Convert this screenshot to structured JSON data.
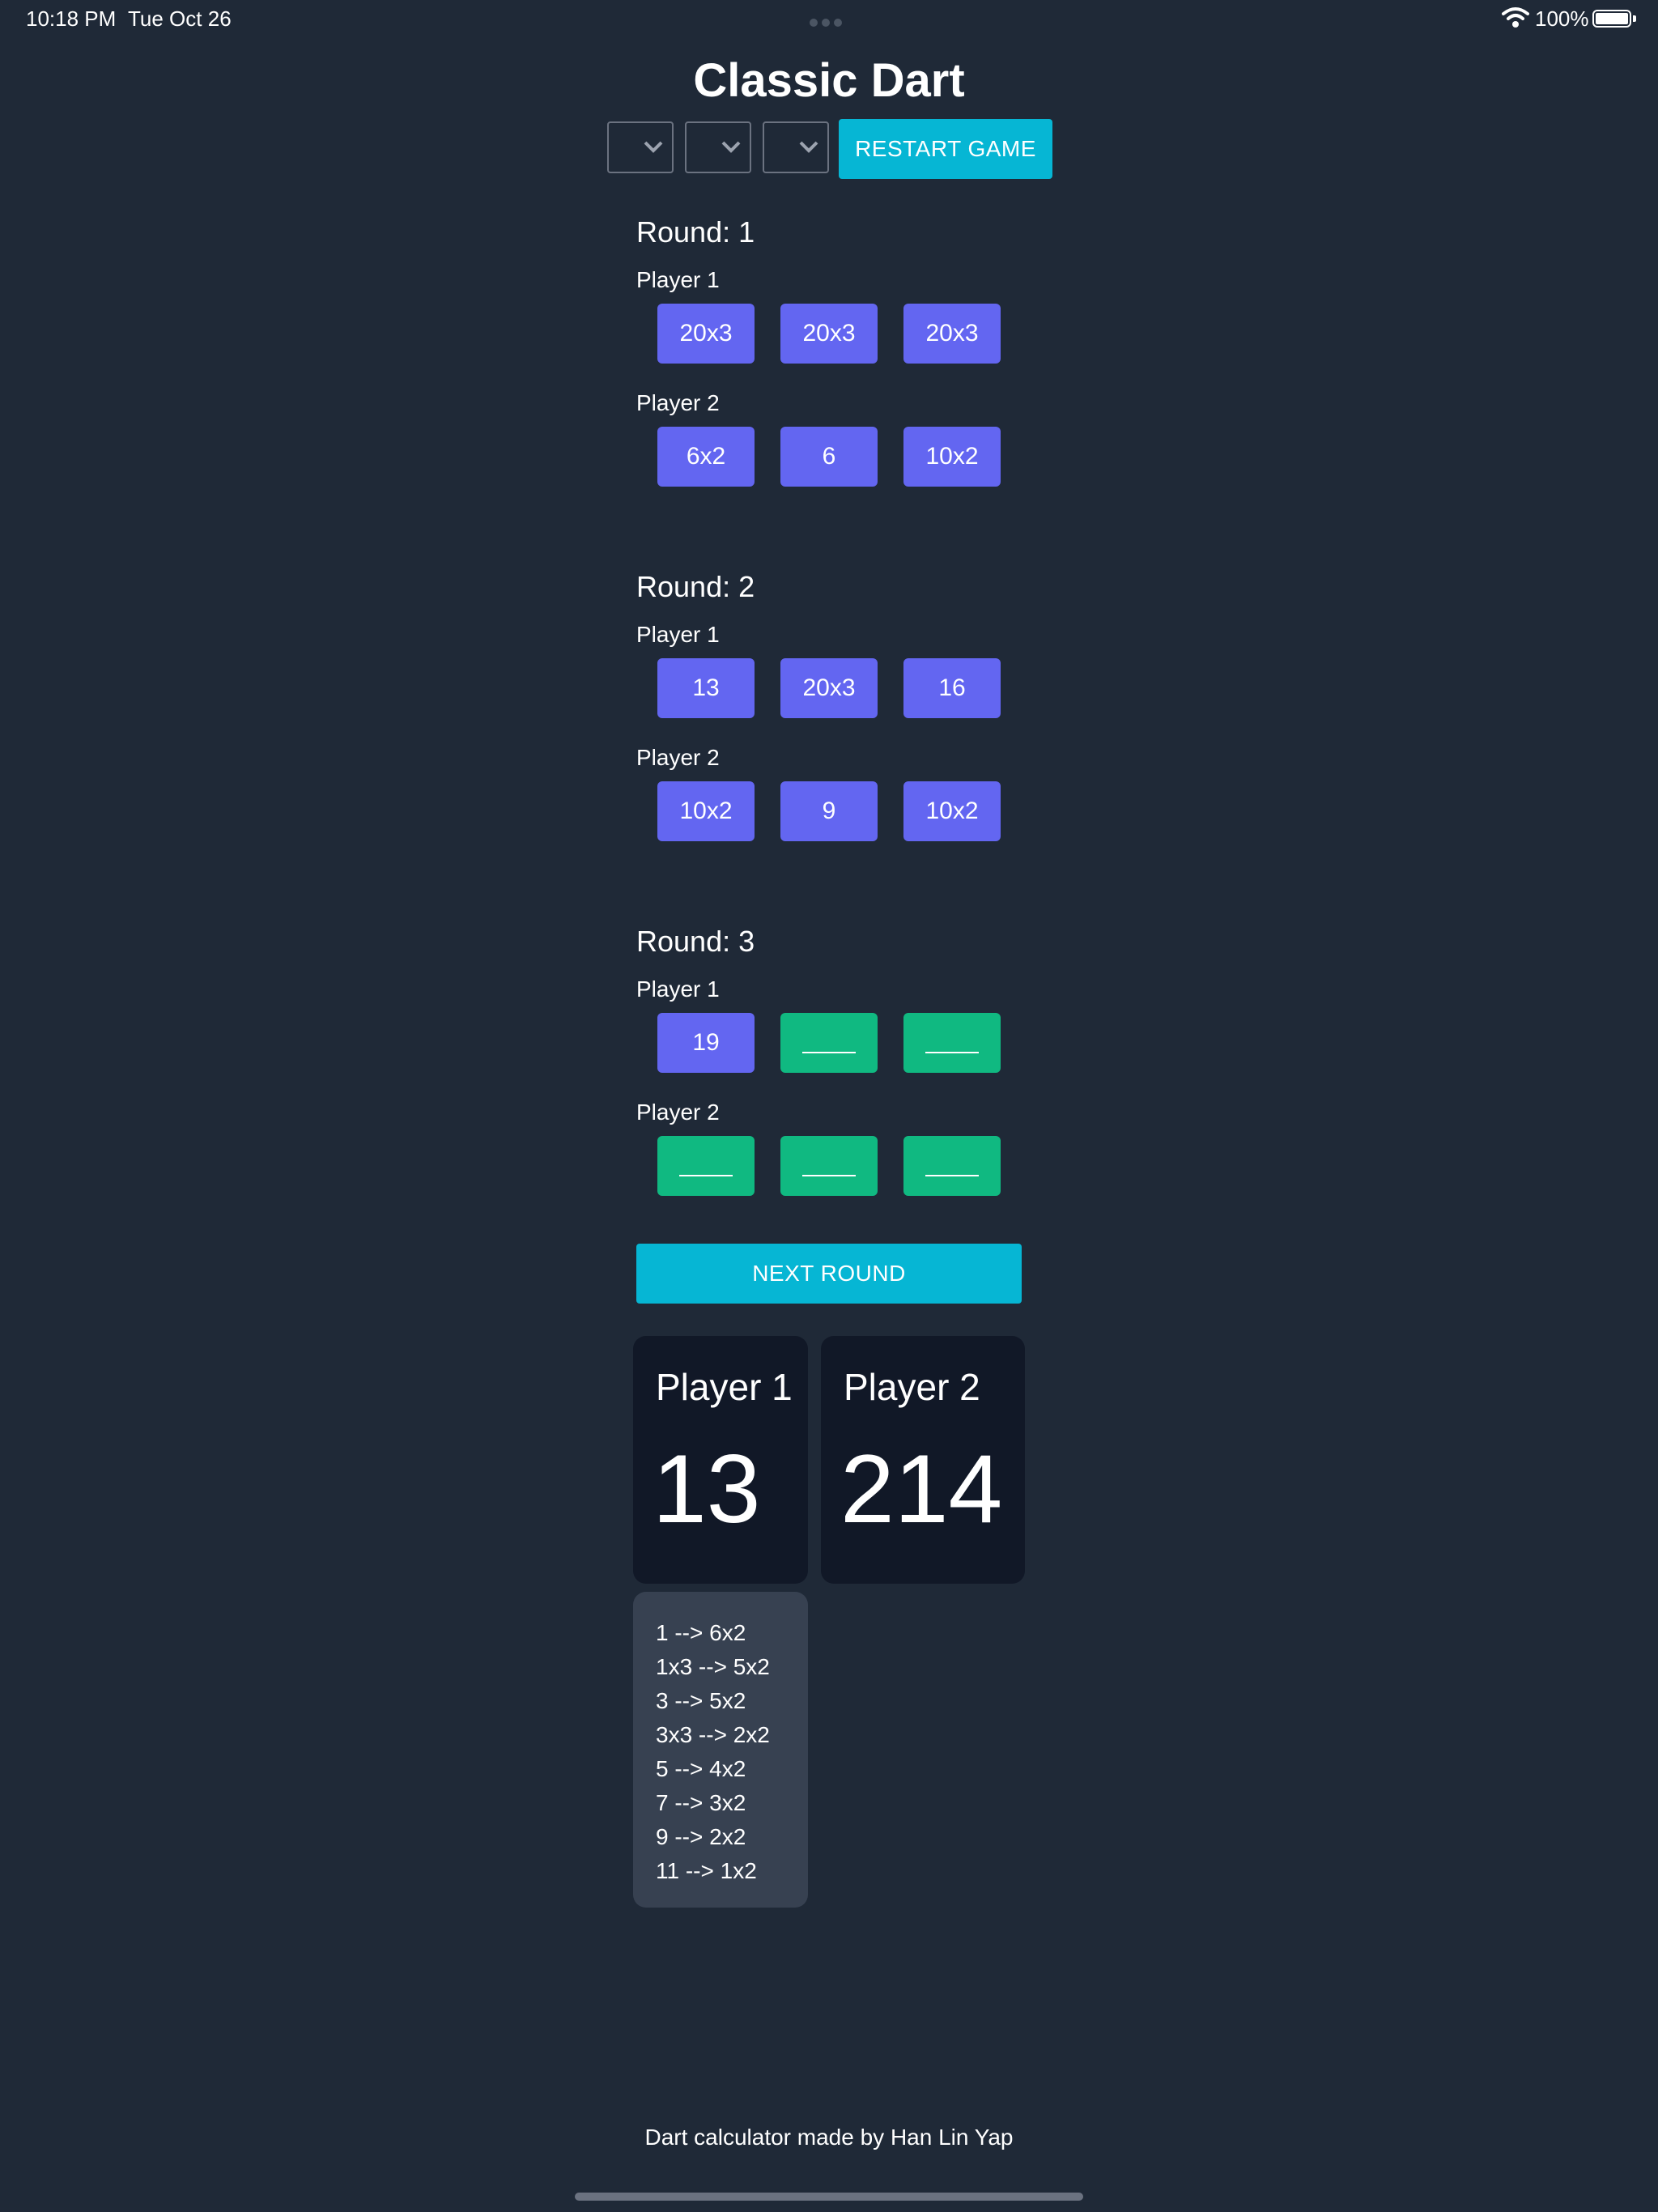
{
  "status_bar": {
    "time": "10:18 PM",
    "date": "Tue Oct 26",
    "battery": "100%"
  },
  "app": {
    "title": "Classic Dart",
    "restart_label": "RESTART GAME",
    "next_round_label": "NEXT ROUND"
  },
  "selects": [
    {
      "value": ""
    },
    {
      "value": ""
    },
    {
      "value": ""
    }
  ],
  "rounds": [
    {
      "label": "Round: 1",
      "players": [
        {
          "label": "Player 1",
          "darts": [
            "20x3",
            "20x3",
            "20x3"
          ]
        },
        {
          "label": "Player 2",
          "darts": [
            "6x2",
            "6",
            "10x2"
          ]
        }
      ]
    },
    {
      "label": "Round: 2",
      "players": [
        {
          "label": "Player 1",
          "darts": [
            "13",
            "20x3",
            "16"
          ]
        },
        {
          "label": "Player 2",
          "darts": [
            "10x2",
            "9",
            "10x2"
          ]
        }
      ]
    },
    {
      "label": "Round: 3",
      "players": [
        {
          "label": "Player 1",
          "darts": [
            "19",
            "",
            ""
          ]
        },
        {
          "label": "Player 2",
          "darts": [
            "",
            "",
            ""
          ]
        }
      ]
    }
  ],
  "scores": [
    {
      "name": "Player 1",
      "score": "13"
    },
    {
      "name": "Player 2",
      "score": "214"
    }
  ],
  "checkouts": [
    "1 --> 6x2",
    "1x3 --> 5x2",
    "3 --> 5x2",
    "3x3 --> 2x2",
    "5 --> 4x2",
    "7 --> 3x2",
    "9 --> 2x2",
    "11 --> 1x2"
  ],
  "footer": "Dart calculator made by Han Lin Yap",
  "colors": {
    "background": "#1f2937",
    "dart_filled": "#6366f1",
    "dart_empty": "#10b981",
    "accent": "#06b6d4",
    "card": "#111827",
    "checkout_card": "#374151"
  }
}
